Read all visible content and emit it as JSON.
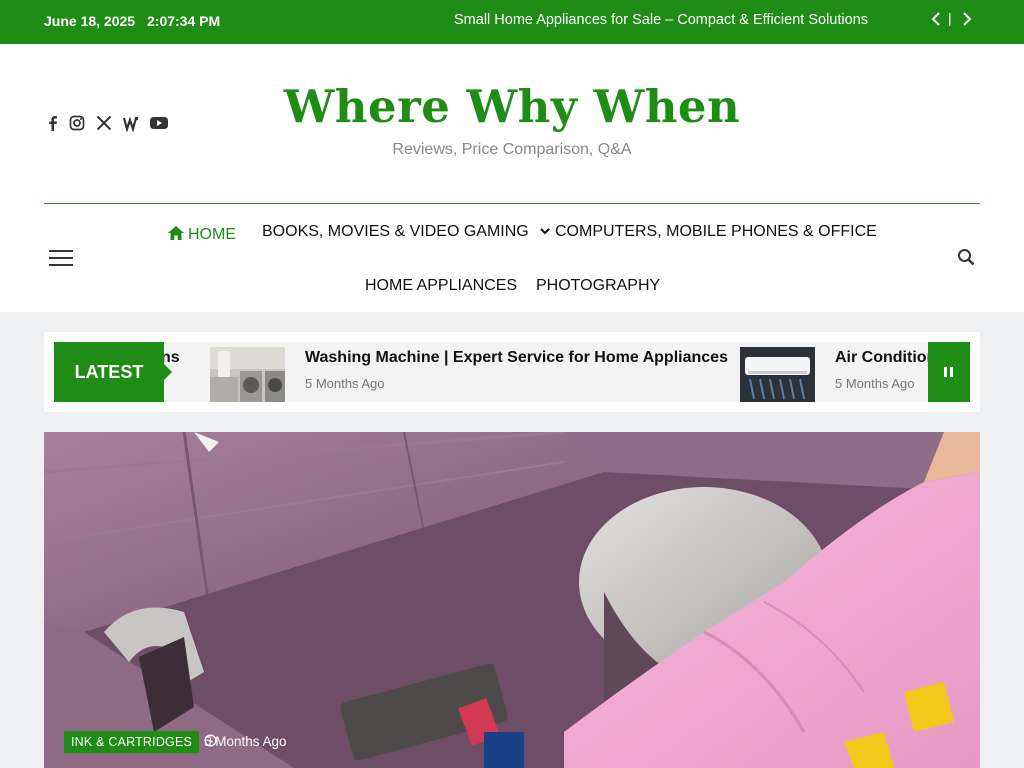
{
  "topbar": {
    "date": "June 18, 2025",
    "time": "2:07:34 PM",
    "headline": "Small Home Appliances for Sale – Compact & Efficient Solutions",
    "separator": "|"
  },
  "header": {
    "site_title": "Where Why When",
    "tagline": "Reviews, Price Comparison, Q&A",
    "socials": [
      "facebook-icon",
      "instagram-icon",
      "x-icon",
      "wordpress-icon",
      "youtube-icon"
    ]
  },
  "menu": {
    "items": [
      {
        "label": "HOME",
        "icon": "home-icon"
      },
      {
        "label": "BOOKS, MOVIES & VIDEO GAMING",
        "icon": "chevron-down-icon"
      },
      {
        "label": "COMPUTERS, MOBILE PHONES & OFFICE"
      },
      {
        "label": "HOME APPLIANCES"
      },
      {
        "label": "PHOTOGRAPHY"
      }
    ]
  },
  "ticker": {
    "label": "LATEST",
    "items": [
      {
        "title": "ns",
        "meta": ""
      },
      {
        "title": "Washing Machine | Expert Service for Home Appliances",
        "meta": "5 Months Ago"
      },
      {
        "title": "Air Conditior",
        "meta": "5 Months Ago"
      }
    ]
  },
  "featured": {
    "category": "INK & CARTRIDGES",
    "meta": "5 Months Ago"
  },
  "colors": {
    "brand": "#1f8c16",
    "background": "#eef0f2",
    "white": "#ffffff"
  }
}
